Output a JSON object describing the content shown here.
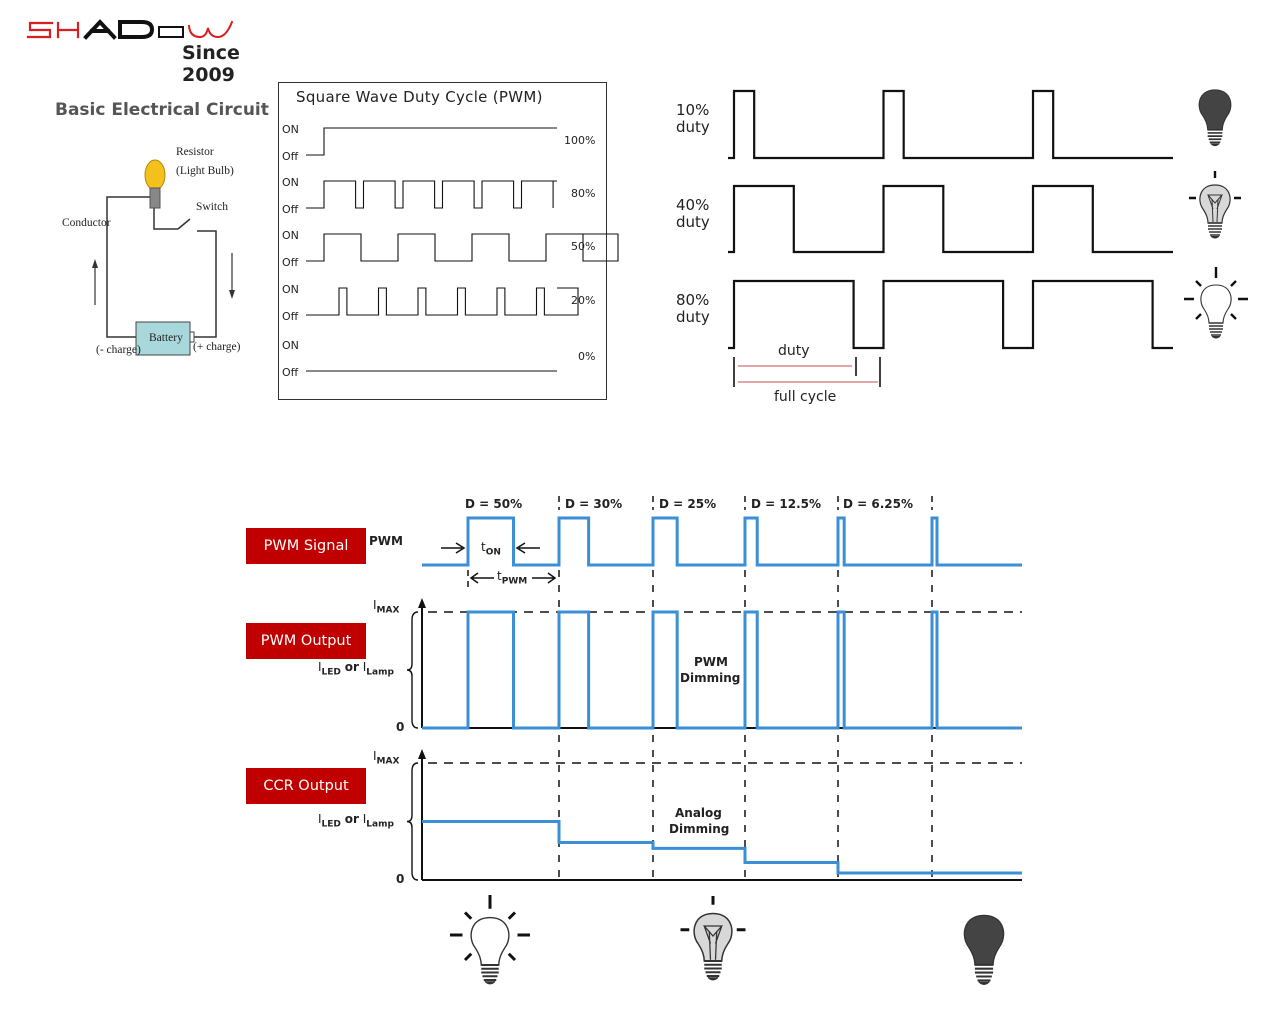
{
  "logo": {
    "brand": "SHADOW",
    "tagline": "Since 2009",
    "brand_color": "#d81e1e"
  },
  "circuit": {
    "title": "Basic Electrical Circuit",
    "labels": {
      "resistor": "Resistor",
      "light_bulb": "(Light Bulb)",
      "switch": "Switch",
      "conductor": "Conductor",
      "battery": "Battery",
      "neg_charge": "(- charge)",
      "pos_charge": "(+ charge)"
    }
  },
  "square_wave": {
    "title": "Square Wave Duty Cycle (PWM)",
    "on_label": "ON",
    "off_label": "Off",
    "rows": [
      {
        "percent": "100%",
        "duty": 1.0
      },
      {
        "percent": "80%",
        "duty": 0.8
      },
      {
        "percent": "50%",
        "duty": 0.5
      },
      {
        "percent": "20%",
        "duty": 0.2
      },
      {
        "percent": "0%",
        "duty": 0.0
      }
    ]
  },
  "duty_examples": {
    "rows": [
      {
        "line1": "10%",
        "line2": "duty",
        "duty": 0.1,
        "bulb": "dark-bulb-icon"
      },
      {
        "line1": "40%",
        "line2": "duty",
        "duty": 0.4,
        "bulb": "dim-bulb-icon"
      },
      {
        "line1": "80%",
        "line2": "duty",
        "duty": 0.8,
        "bulb": "bright-bulb-icon"
      }
    ],
    "duty_label": "duty",
    "full_cycle_label": "full cycle",
    "measure_color": "#d98888"
  },
  "dimming": {
    "signal_color": "#3a8fd6",
    "labels": {
      "pwm_signal": "PWM Signal",
      "pwm_output": "PWM Output",
      "ccr_output": "CCR Output",
      "pwm": "PWM",
      "t_on": "t",
      "t_on_sub": "ON",
      "t_pwm": "t",
      "t_pwm_sub": "PWM",
      "imax": "I",
      "imax_sub": "MAX",
      "iled": "I",
      "iled_sub": "LED",
      "or": "or",
      "ilamp": "I",
      "ilamp_sub": "Lamp",
      "zero": "0",
      "pwm_dimming_1": "PWM",
      "pwm_dimming_2": "Dimming",
      "analog_dimming_1": "Analog",
      "analog_dimming_2": "Dimming"
    },
    "box_color": "#c00000",
    "periods": [
      {
        "label": "D = 50%",
        "duty": 0.5
      },
      {
        "label": "D = 30%",
        "duty": 0.3
      },
      {
        "label": "D = 25%",
        "duty": 0.25
      },
      {
        "label": "D = 12.5%",
        "duty": 0.125
      },
      {
        "label": "D = 6.25%",
        "duty": 0.0625
      }
    ],
    "ccr_levels_fraction_of_imax": [
      0.5,
      0.32,
      0.27,
      0.15,
      0.06
    ],
    "bulbs": [
      "bright-bulb-icon",
      "dim-bulb-icon",
      "dark-bulb-icon"
    ]
  }
}
